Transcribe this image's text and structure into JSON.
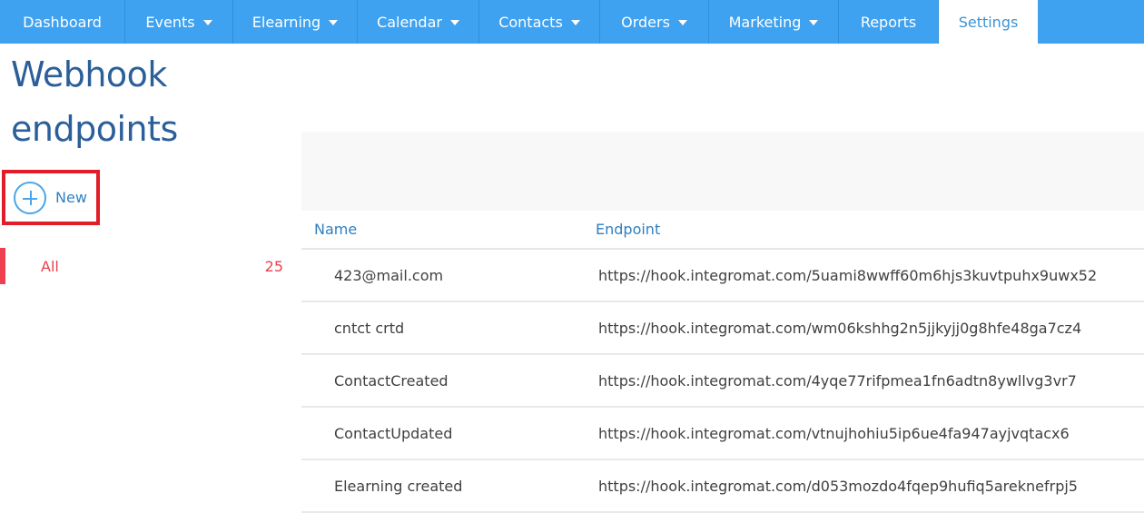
{
  "nav": {
    "items": [
      {
        "label": "Dashboard",
        "has_caret": false
      },
      {
        "label": "Events",
        "has_caret": true
      },
      {
        "label": "Elearning",
        "has_caret": true
      },
      {
        "label": "Calendar",
        "has_caret": true
      },
      {
        "label": "Contacts",
        "has_caret": true
      },
      {
        "label": "Orders",
        "has_caret": true
      },
      {
        "label": "Marketing",
        "has_caret": true
      },
      {
        "label": "Reports",
        "has_caret": false
      },
      {
        "label": "Settings",
        "has_caret": false,
        "active": true
      }
    ],
    "colors": {
      "bar": "#3ea2f0",
      "active_text": "#3c93d4"
    }
  },
  "page": {
    "title": "Webhook endpoints",
    "new_button": {
      "label": "New",
      "icon": "plus-circle-icon",
      "highlight_color": "#e21d2a"
    }
  },
  "filters": [
    {
      "label": "All",
      "count": "25",
      "active": true,
      "color": "#e8404c"
    }
  ],
  "table": {
    "columns": [
      "Name",
      "Endpoint"
    ],
    "rows": [
      {
        "name": "423@mail.com",
        "endpoint": "https://hook.integromat.com/5uami8wwff60m6hjs3kuvtpuhx9uwx52"
      },
      {
        "name": "cntct crtd",
        "endpoint": "https://hook.integromat.com/wm06kshhg2n5jjkyjj0g8hfe48ga7cz4"
      },
      {
        "name": "ContactCreated",
        "endpoint": "https://hook.integromat.com/4yqe77rifpmea1fn6adtn8ywllvg3vr7"
      },
      {
        "name": "ContactUpdated",
        "endpoint": "https://hook.integromat.com/vtnujhohiu5ip6ue4fa947ayjvqtacx6"
      },
      {
        "name": "Elearning created",
        "endpoint": "https://hook.integromat.com/d053mozdo4fqep9hufiq5areknefrpj5"
      }
    ]
  }
}
